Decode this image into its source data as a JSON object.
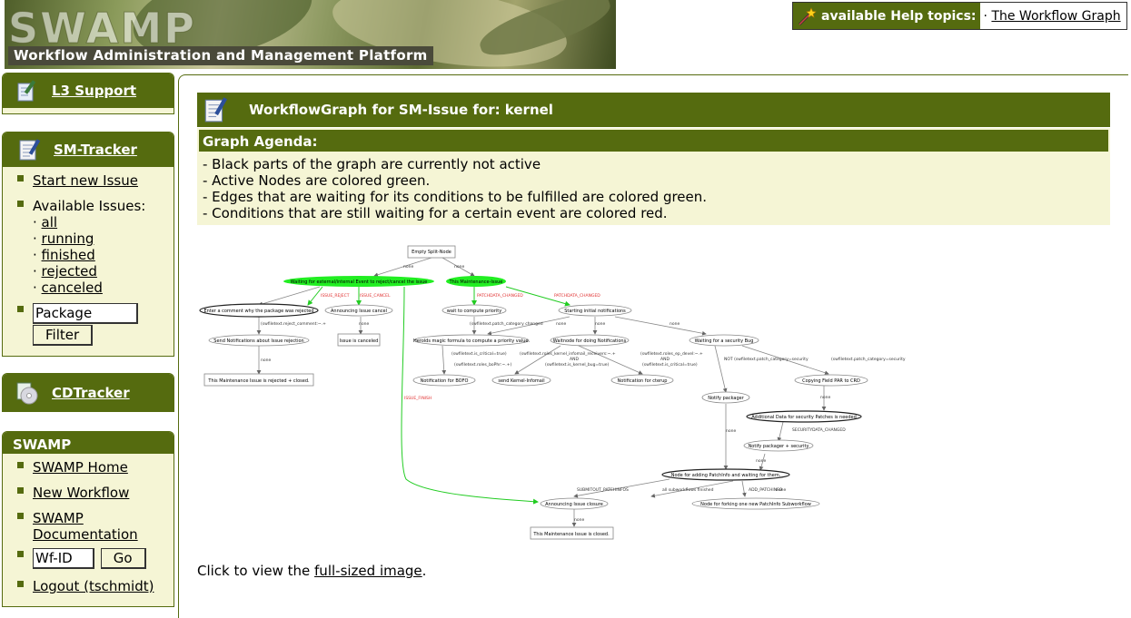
{
  "banner": {
    "logo_text": "SWAMP",
    "subtitle": "Workflow Administration and Management Platform"
  },
  "help": {
    "label": "available Help topics:",
    "separator": "·",
    "link": "The Workflow Graph"
  },
  "sidebar": {
    "l3": {
      "title": "L3 Support",
      "icon": "document-pencil-icon"
    },
    "smtracker": {
      "title": "SM-Tracker",
      "icon": "notepad-pencil-icon",
      "start_new": "Start new Issue",
      "available_label": "Available Issues:",
      "issues": [
        "all",
        "running",
        "finished",
        "rejected",
        "canceled"
      ],
      "package_value": "Package",
      "filter_label": "Filter"
    },
    "cdtracker": {
      "title": "CDTracker",
      "icon": "cd-icon"
    },
    "swamp": {
      "title": "SWAMP",
      "home": "SWAMP Home",
      "new_workflow": "New Workflow",
      "documentation": "SWAMP Documentation",
      "wfid_value": "Wf-ID",
      "go_label": "Go",
      "logout": "Logout (tschmidt)"
    }
  },
  "main": {
    "title": "WorkflowGraph for SM-Issue for: kernel",
    "agenda_title": "Graph Agenda:",
    "agenda_lines": [
      "- Black parts of the graph are currently not active",
      "- Active Nodes are colored green.",
      "- Edges that are waiting for its conditions to be fulfilled are colored green.",
      "- Conditions that are still waiting for a certain event are colored red."
    ],
    "click_prefix": "Click to view the ",
    "click_link": "full-sized image",
    "click_suffix": "."
  },
  "graph": {
    "nodes": {
      "n1": "Empty Split-Node",
      "n2": "Waiting for external/internal Event to reject/cancel the issue",
      "n3": "This Maintenance-Issue",
      "n4": "Enter a comment why the package was rejected",
      "n5": "Announcing Issue cancel",
      "n6": "wait to compute priority",
      "n7": "Starting initial notifications",
      "n8": "Send Notifications about Issue rejection",
      "n9": "Issue is canceled",
      "n10": "Herolds magic formula to compute a priority value.",
      "n11": "Waitnode for doing Notifications",
      "n12": "Waiting for a security Bug",
      "n13": "This Maintenance Issue is rejected + closed.",
      "n14": "Notification for BOFO",
      "n15": "send Kernel-Infomail",
      "n16": "Notification for cterup",
      "n17": "Copying Field PAR to CRD",
      "n18": "Notify packager",
      "n19": "Additional Data for security Patches is needed",
      "n20": "Notify packager + security",
      "n21": "Node for adding PatchInfo and waiting for them.",
      "n22": "Announcing Issue closure",
      "n23": "Node for forking one new PatchInfo Subworkflow",
      "n24": "This Maintenance Issue is closed."
    },
    "edges": {
      "e1": "none",
      "e2": "none",
      "e3": "ISSUE_REJECT",
      "e4": "ISSUE_CANCEL",
      "e5": "PATCHDATA_CHANGED",
      "e6": "PATCHDATA_CHANGED",
      "e7": "(swfiletext.reject_comment:~.+",
      "e8": "none",
      "e9": "(swfiletext.patch_category changed",
      "e10": "none",
      "e11": "none",
      "e12": "none",
      "e13": "none",
      "e14": "(swfiletext.is_critical=true)",
      "e15": "(swfiletext.roles_kernel_infomail_receivers:~.+",
      "e16": "AND",
      "e17": "(swfiletext.roles_boPhr:~.+)",
      "e18": "(swfiletext.is_kernel_bug=true)",
      "e19": "(swfiletext.roles_ep_devel:~.+",
      "e20": "AND",
      "e21": "(swfiletext.is_critical=true)",
      "e22": "NOT (swfiletext.patch_category=security",
      "e23": "(swfiletext.patch_category=security",
      "e24": "ISSUE_FINISH",
      "e25": "none",
      "e26": "SECURITYDATA_CHANGED",
      "e27": "none",
      "e28": "none",
      "e29": "SUBMITOUT_PATCHINFOS",
      "e30": "all subworkflows finished",
      "e31": "ADD_PATCHINFO",
      "e32": "none",
      "e33": "none"
    }
  }
}
